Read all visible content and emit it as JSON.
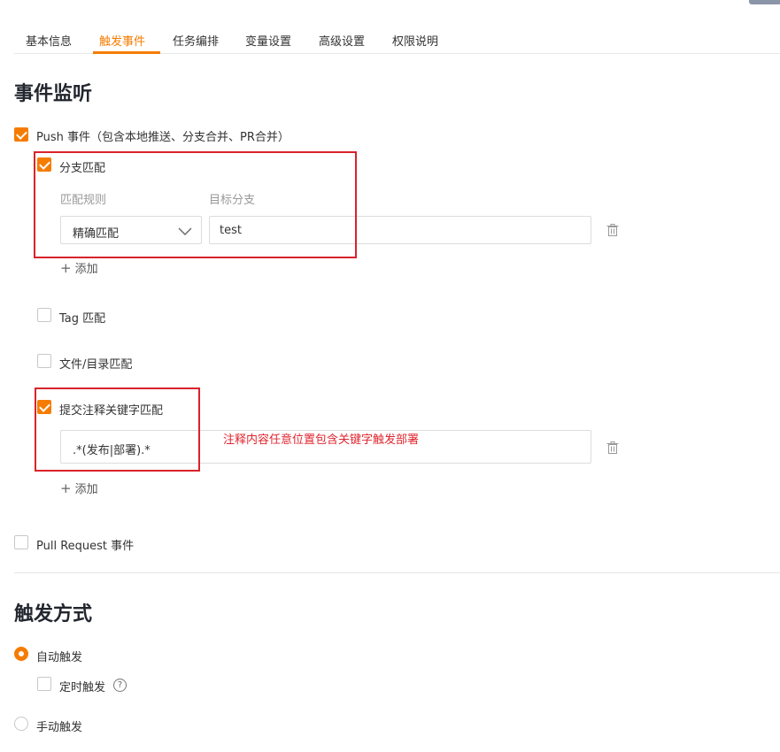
{
  "tabs": [
    {
      "label": "基本信息"
    },
    {
      "label": "触发事件"
    },
    {
      "label": "任务编排"
    },
    {
      "label": "变量设置"
    },
    {
      "label": "高级设置"
    },
    {
      "label": "权限说明"
    }
  ],
  "active_tab": "触发事件",
  "event_section": {
    "title": "事件监听",
    "push": {
      "label": "Push 事件（包含本地推送、分支合并、PR合并）",
      "checked": true,
      "branch_match": {
        "label": "分支匹配",
        "checked": true,
        "rule_header": "匹配规则",
        "target_header": "目标分支",
        "rule_value": "精确匹配",
        "target_value": "test",
        "add_label": "添加"
      },
      "tag_match": {
        "label": "Tag 匹配",
        "checked": false
      },
      "file_match": {
        "label": "文件/目录匹配",
        "checked": false
      },
      "commit_match": {
        "label": "提交注释关键字匹配",
        "checked": true,
        "pattern_value": ".*(发布|部署).*",
        "add_label": "添加"
      }
    },
    "annotation": "注释内容任意位置包含关键字触发部署",
    "pull_request": {
      "label": "Pull Request 事件",
      "checked": false
    }
  },
  "trigger_section": {
    "title": "触发方式",
    "auto": {
      "label": "自动触发",
      "selected": true
    },
    "scheduled": {
      "label": "定时触发",
      "checked": false,
      "help_glyph": "?"
    },
    "manual": {
      "label": "手动触发",
      "selected": false
    }
  },
  "colors": {
    "accent": "#f57c00",
    "annotation_red": "#d9232a"
  },
  "icons": {
    "delete": "trash-icon",
    "add": "plus-icon",
    "dropdown": "chevron-down-icon",
    "help": "question-circle-icon"
  }
}
